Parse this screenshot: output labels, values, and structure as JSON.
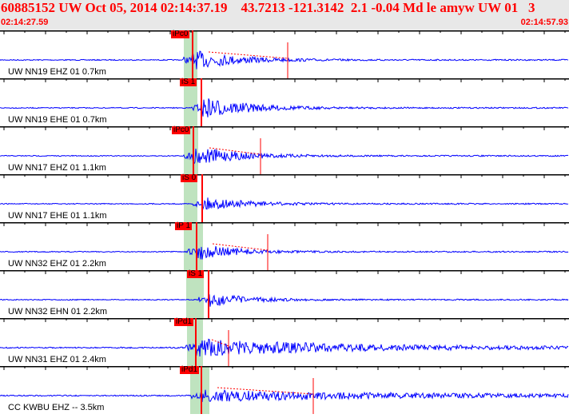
{
  "header": {
    "title": "60885152 UW Oct 05, 2014 02:14:37.19    43.7213 -121.3142  2.1 -0.04 Md le amyw UW 01   3",
    "start_time": "02:14:27.59",
    "end_time": "02:14:57.93"
  },
  "colors": {
    "trace": "#0000ff",
    "pick": "#ff0000",
    "window": "#bfe3bf",
    "header_text": "#ff0000"
  },
  "channels": [
    {
      "label": "UW NN19 EHZ 01 0.7km",
      "pick": "iPc0"
    },
    {
      "label": "UW NN19 EHE 01 0.7km",
      "pick": "iS 1"
    },
    {
      "label": "UW NN17 EHZ 01 1.1km",
      "pick": "iPc0"
    },
    {
      "label": "UW NN17 EHE 01 1.1km",
      "pick": "iS 0"
    },
    {
      "label": "UW NN32 EHZ 01 2.2km",
      "pick": "iP 1"
    },
    {
      "label": "UW NN32 EHN 01 2.2km",
      "pick": "iS 1"
    },
    {
      "label": "UW NN31 EHZ 01 2.4km",
      "pick": "iPd1"
    },
    {
      "label": "CC KWBU EHZ -- 3.5km",
      "pick": "iPd1"
    }
  ]
}
